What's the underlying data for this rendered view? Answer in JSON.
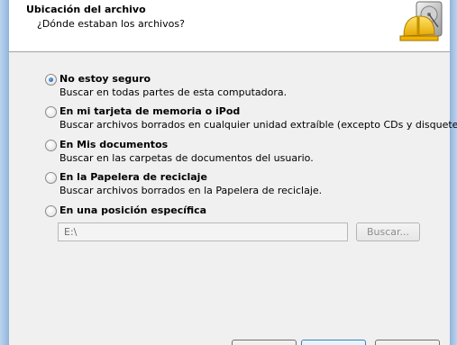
{
  "header": {
    "title": "Ubicación del archivo",
    "subtitle": "¿Dónde estaban los archivos?",
    "logo_icon": "hard-drive-with-hardhat-icon"
  },
  "options": [
    {
      "label": "No estoy seguro",
      "description": "Buscar en todas partes de esta computadora.",
      "checked": true
    },
    {
      "label": "En mi tarjeta de memoria o iPod",
      "description": "Buscar archivos borrados en cualquier unidad extraíble (excepto CDs y disquetes).",
      "checked": false
    },
    {
      "label": "En Mis documentos",
      "description": "Buscar en las carpetas de documentos del usuario.",
      "checked": false
    },
    {
      "label": "En la Papelera de reciclaje",
      "description": "Buscar archivos borrados en la Papelera de reciclaje.",
      "checked": false
    },
    {
      "label": "En una posición específica",
      "description": "",
      "checked": false
    }
  ],
  "specific_location": {
    "path_value": "E:\\",
    "browse_label": "Buscar..."
  },
  "colors": {
    "accent": "#2a67b1",
    "frame": "#a3c2e4",
    "background": "#f0f0f0"
  }
}
